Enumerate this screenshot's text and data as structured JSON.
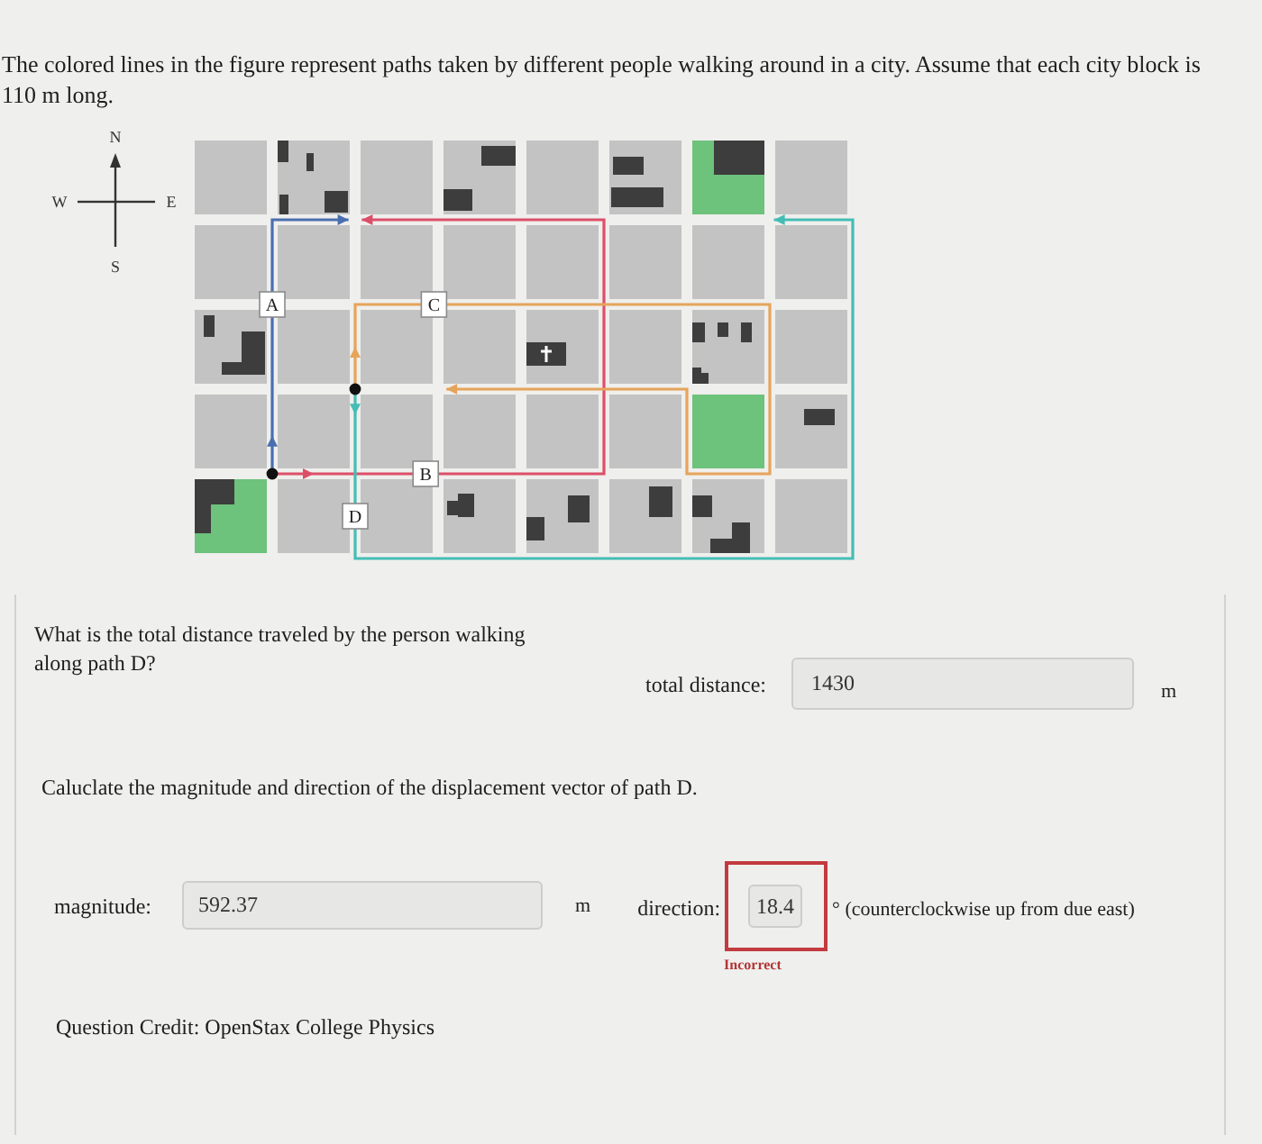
{
  "intro": "The colored lines in the figure represent paths taken by different people walking around in a city. Assume that each city block is 110 m long.",
  "figure": {
    "compass": {
      "north": "N",
      "south": "S",
      "west": "W",
      "east": "E"
    },
    "paths": [
      {
        "label": "A",
        "color": "#4a6fb0"
      },
      {
        "label": "B",
        "color": "#dc4f68"
      },
      {
        "label": "C",
        "color": "#e6a45a"
      },
      {
        "label": "D",
        "color": "#45bdb5"
      }
    ]
  },
  "question_1": {
    "prompt": "What is the total distance traveled by the person walking along path D?",
    "field": {
      "label": "total distance:",
      "value": "1430",
      "unit": "m"
    }
  },
  "question_2": {
    "prompt": "Caluclate the magnitude and direction of the displacement vector of path D.",
    "fields": [
      {
        "label": "magnitude:",
        "value": "592.37",
        "unit": "m",
        "incorrect": false
      },
      {
        "label": "direction:",
        "value": "18.4",
        "unit": "° (counterclockwise up from due east)",
        "incorrect": true,
        "feedback": "Incorrect"
      }
    ]
  },
  "credit": "Question Credit: OpenStax College Physics"
}
